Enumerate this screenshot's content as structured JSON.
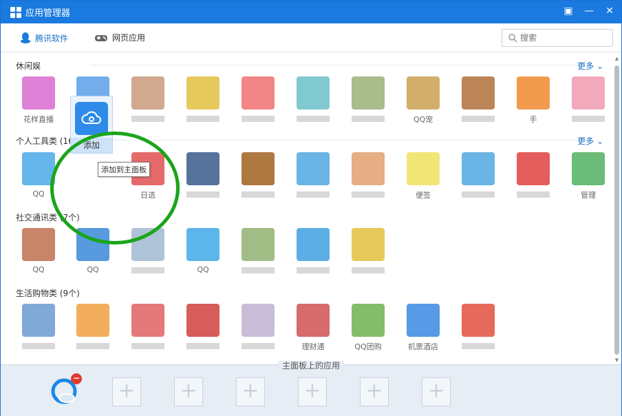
{
  "window": {
    "title": "应用管理器"
  },
  "toolbar": {
    "tabs": [
      {
        "label": "腾讯软件",
        "icon": "qq-penguin-icon"
      },
      {
        "label": "网页应用",
        "icon": "gamepad-icon"
      }
    ],
    "search": {
      "placeholder": "搜索"
    }
  },
  "categories": [
    {
      "title": "休闲娱",
      "more": "更多"
    },
    {
      "title": "个人工具类 (16个)",
      "more": "更多"
    },
    {
      "title": "社交通讯类 (7个)"
    },
    {
      "title": "生活购物类 (9个)"
    }
  ],
  "apps": {
    "row1": [
      {
        "label": "花样直播",
        "color": "#d96bd0"
      },
      {
        "label": "",
        "color": "#5b9fe8"
      },
      {
        "label": "",
        "color": "#c89a7b"
      },
      {
        "label": "",
        "color": "#e0c040"
      },
      {
        "label": "",
        "color": "#f07070"
      },
      {
        "label": "",
        "color": "#6bc0c8"
      },
      {
        "label": "",
        "color": "#9ab078"
      },
      {
        "label": "QQ宠",
        "color": "#c9a050"
      },
      {
        "label": "",
        "color": "#b0703a"
      },
      {
        "label": "手",
        "color": "#f08a30"
      },
      {
        "label": "",
        "color": "#f09ab0"
      }
    ],
    "row2": [
      {
        "label": "QQ",
        "color": "#4aa8e8"
      },
      {
        "label": "添加",
        "color": "#2f8bea"
      },
      {
        "label": "日选",
        "color": "#e05050"
      },
      {
        "label": "",
        "color": "#3a5a8a"
      },
      {
        "label": "",
        "color": "#a06020"
      },
      {
        "label": "",
        "color": "#50a8e0"
      },
      {
        "label": "",
        "color": "#e0a070"
      },
      {
        "label": "便签",
        "color": "#f0e060"
      },
      {
        "label": "",
        "color": "#50a8e0"
      },
      {
        "label": "",
        "color": "#e04040"
      },
      {
        "label": "管理",
        "color": "#50b060"
      }
    ],
    "row3": [
      {
        "label": "QQ",
        "color": "#c07050"
      },
      {
        "label": "QQ",
        "color": "#3a88d8"
      },
      {
        "label": "",
        "color": "#a0b8d0"
      },
      {
        "label": "QQ",
        "color": "#40a8e8"
      },
      {
        "label": "",
        "color": "#90b070"
      },
      {
        "label": "",
        "color": "#40a0e0"
      },
      {
        "label": "",
        "color": "#e0c040"
      }
    ],
    "row4": [
      {
        "label": "",
        "color": "#6a9ad0"
      },
      {
        "label": "",
        "color": "#f0a040"
      },
      {
        "label": "",
        "color": "#e06060"
      },
      {
        "label": "",
        "color": "#d04040"
      },
      {
        "label": "",
        "color": "#c0b0d0"
      },
      {
        "label": "理财通",
        "color": "#d05050"
      },
      {
        "label": "QQ团购",
        "color": "#70b050"
      },
      {
        "label": "机票酒店",
        "color": "#3a88e0"
      },
      {
        "label": "",
        "color": "#e05040"
      }
    ]
  },
  "selected_app": {
    "button_label": "添加",
    "tooltip": "添加到主面板"
  },
  "bottom_panel": {
    "title": "主面板上的应用",
    "remove_symbol": "−",
    "add_symbol": "+"
  }
}
